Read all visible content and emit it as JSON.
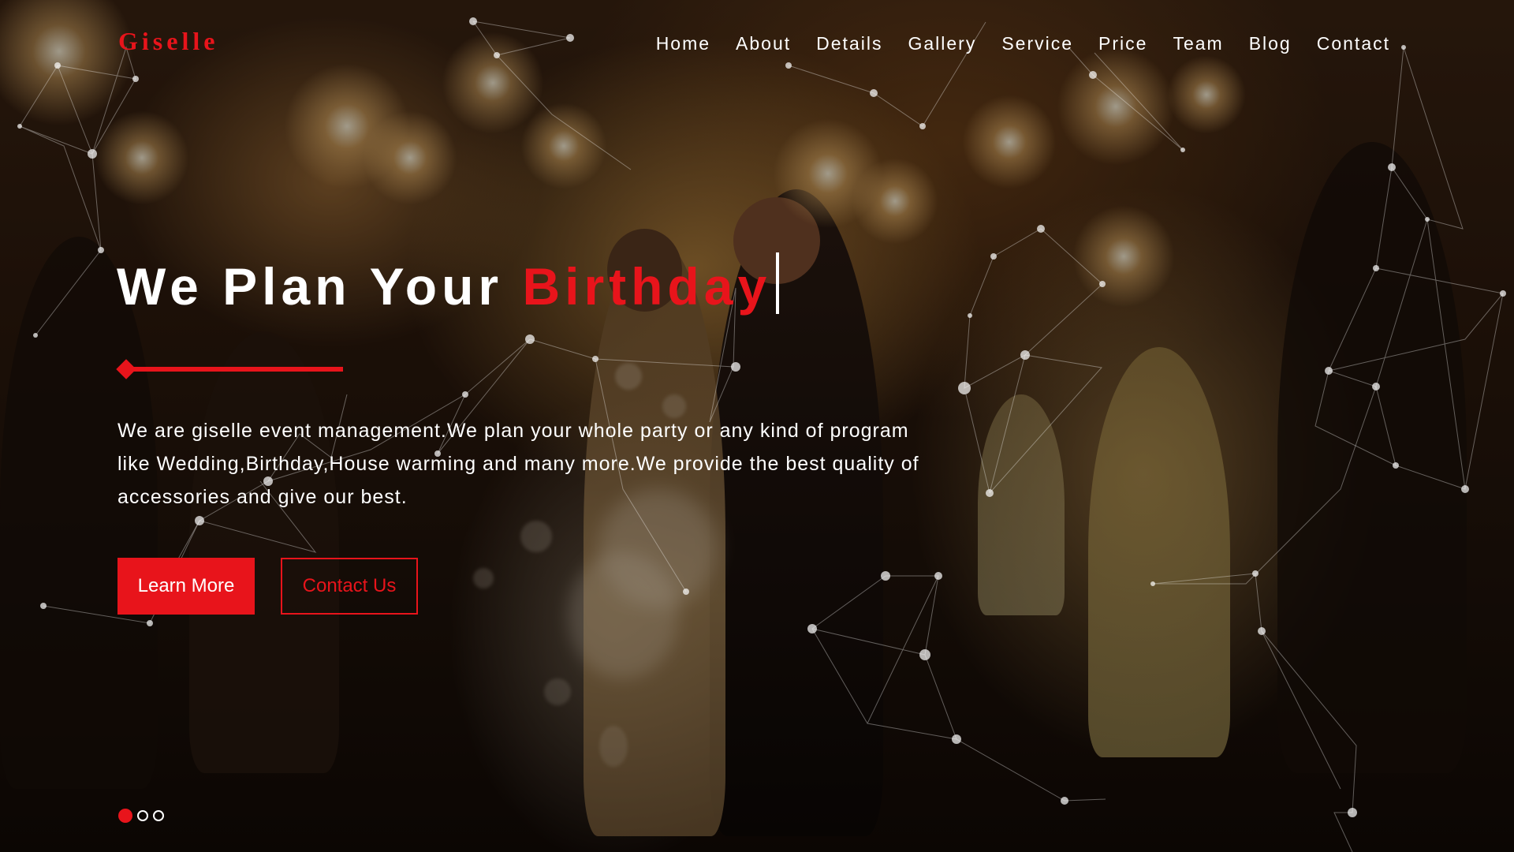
{
  "brand": {
    "logo_text": "Giselle",
    "accent_color": "#e8141b"
  },
  "nav": {
    "items": [
      {
        "label": "Home"
      },
      {
        "label": "About"
      },
      {
        "label": "Details"
      },
      {
        "label": "Gallery"
      },
      {
        "label": "Service"
      },
      {
        "label": "Price"
      },
      {
        "label": "Team"
      },
      {
        "label": "Blog"
      },
      {
        "label": "Contact"
      }
    ]
  },
  "hero": {
    "headline_prefix": "We Plan Your",
    "headline_highlight": "Birthday",
    "description": "We are giselle event management.We plan your whole party or any kind of program like Wedding,Birthday,House warming and many more.We provide the best quality of accessories and give our best.",
    "primary_button": "Learn More",
    "secondary_button": "Contact Us",
    "background_image": "wedding couple walking through sparkler send-off"
  },
  "slider": {
    "slide_count": 3,
    "active_index": 0
  }
}
